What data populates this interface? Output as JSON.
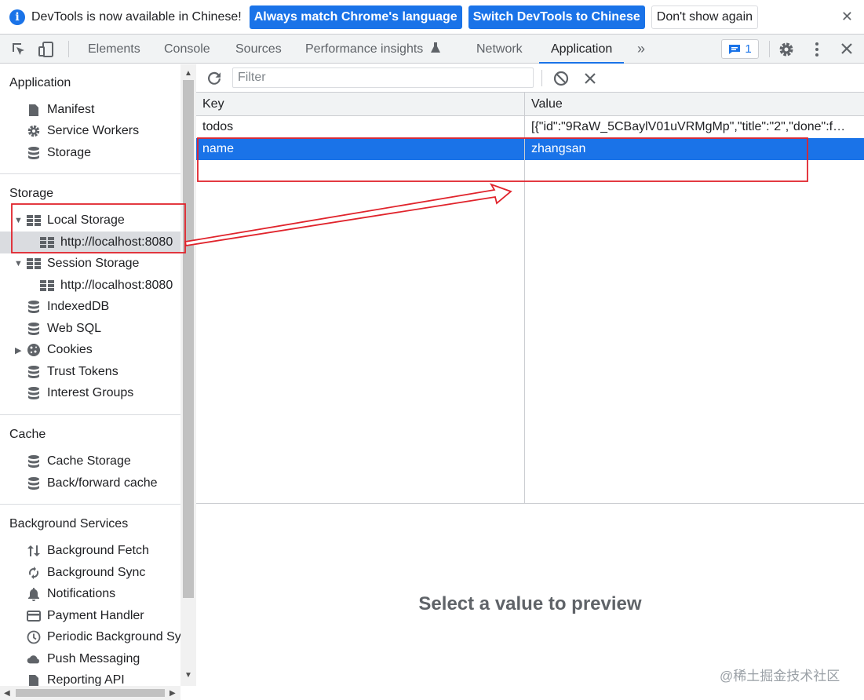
{
  "infobar": {
    "message": "DevTools is now available in Chinese!",
    "btn_match": "Always match Chrome's language",
    "btn_switch": "Switch DevTools to Chinese",
    "btn_dont_show": "Don't show again",
    "close": "✕"
  },
  "tabs": {
    "elements": "Elements",
    "console": "Console",
    "sources": "Sources",
    "performance": "Performance insights",
    "network": "Network",
    "application": "Application",
    "more": "»",
    "issues_count": "1"
  },
  "sidebar": {
    "application_header": "Application",
    "manifest": "Manifest",
    "service_workers": "Service Workers",
    "storage_item": "Storage",
    "storage_header": "Storage",
    "local_storage": "Local Storage",
    "local_origin": "http://localhost:8080",
    "session_storage": "Session Storage",
    "session_origin": "http://localhost:8080",
    "indexeddb": "IndexedDB",
    "websql": "Web SQL",
    "cookies": "Cookies",
    "trust_tokens": "Trust Tokens",
    "interest_groups": "Interest Groups",
    "cache_header": "Cache",
    "cache_storage": "Cache Storage",
    "bf_cache": "Back/forward cache",
    "bg_header": "Background Services",
    "bg_fetch": "Background Fetch",
    "bg_sync": "Background Sync",
    "notifications": "Notifications",
    "payment_handler": "Payment Handler",
    "periodic_sync": "Periodic Background Sy",
    "push_messaging": "Push Messaging",
    "reporting_api": "Reporting API"
  },
  "toolbar": {
    "filter_placeholder": "Filter"
  },
  "grid": {
    "key_header": "Key",
    "value_header": "Value",
    "rows": [
      {
        "key": "todos",
        "value": "[{\"id\":\"9RaW_5CBaylV01uVRMgMp\",\"title\":\"2\",\"done\":f…"
      },
      {
        "key": "name",
        "value": "zhangsan"
      }
    ]
  },
  "preview": {
    "empty_text": "Select a value to preview"
  },
  "watermark": "@稀土掘金技术社区",
  "colors": {
    "accent": "#1a73e8",
    "annotation": "#e0242c"
  }
}
